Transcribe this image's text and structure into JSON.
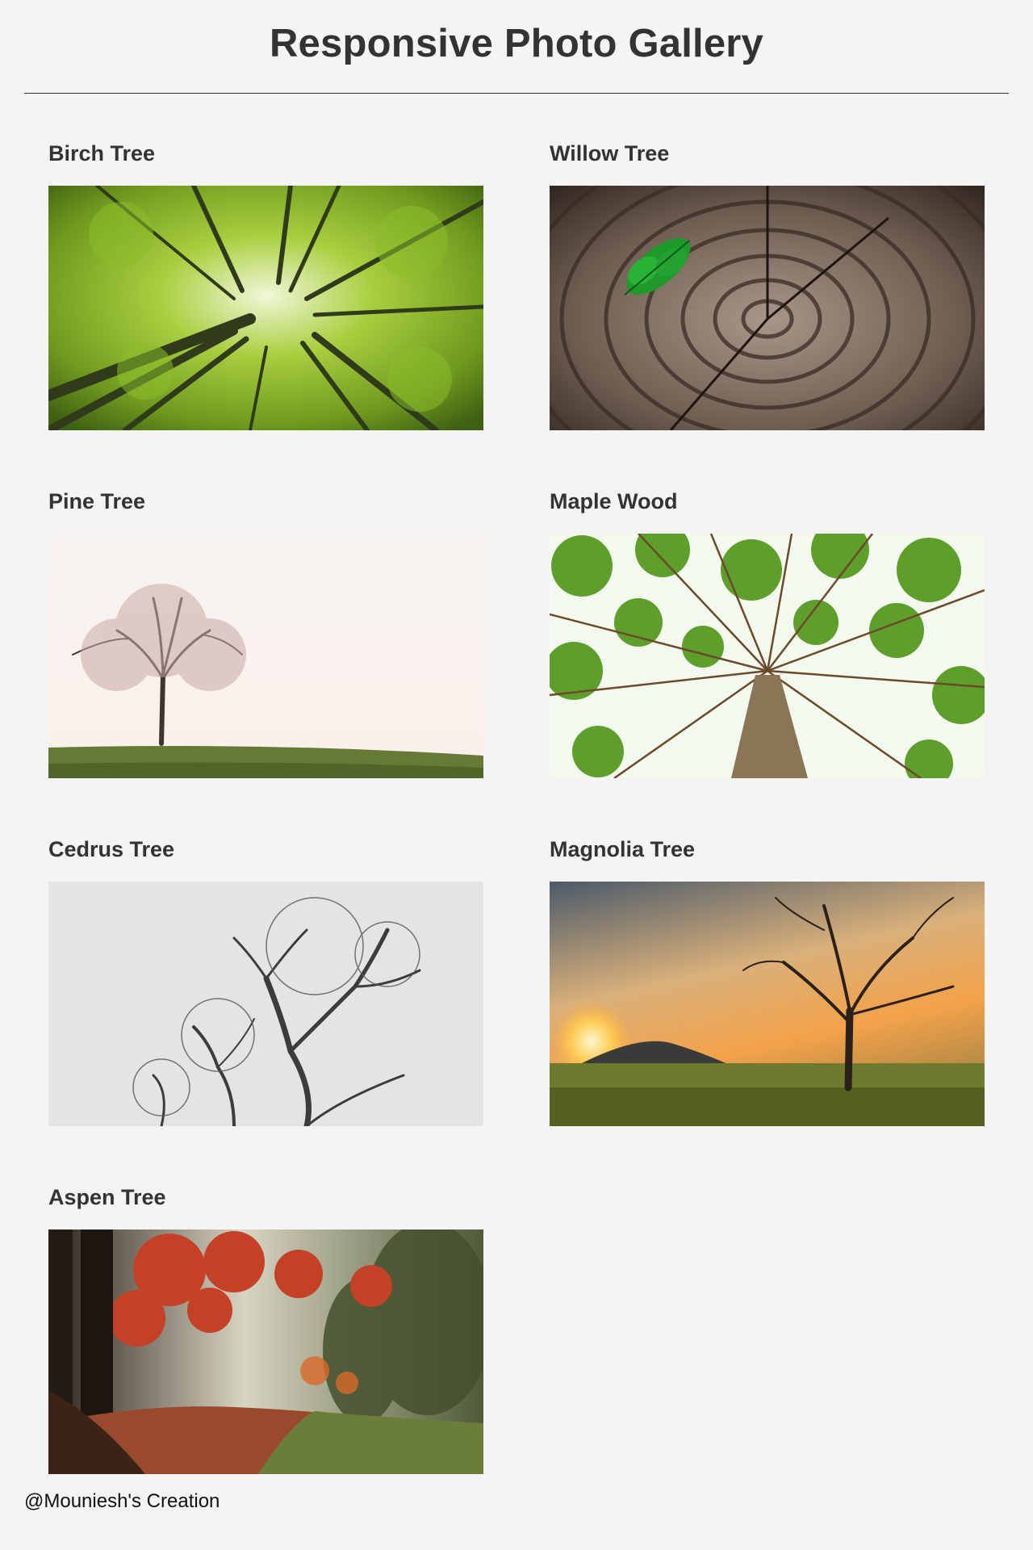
{
  "header": {
    "title": "Responsive Photo Gallery"
  },
  "gallery": {
    "items": [
      {
        "name": "Birch Tree"
      },
      {
        "name": "Willow Tree"
      },
      {
        "name": "Pine Tree"
      },
      {
        "name": "Maple Wood"
      },
      {
        "name": "Cedrus Tree"
      },
      {
        "name": "Magnolia Tree"
      },
      {
        "name": "Aspen Tree"
      }
    ]
  },
  "footer": {
    "credit": "@Mouniesh's Creation"
  },
  "colors": {
    "background": "#f4f4f4",
    "text": "#333333"
  }
}
